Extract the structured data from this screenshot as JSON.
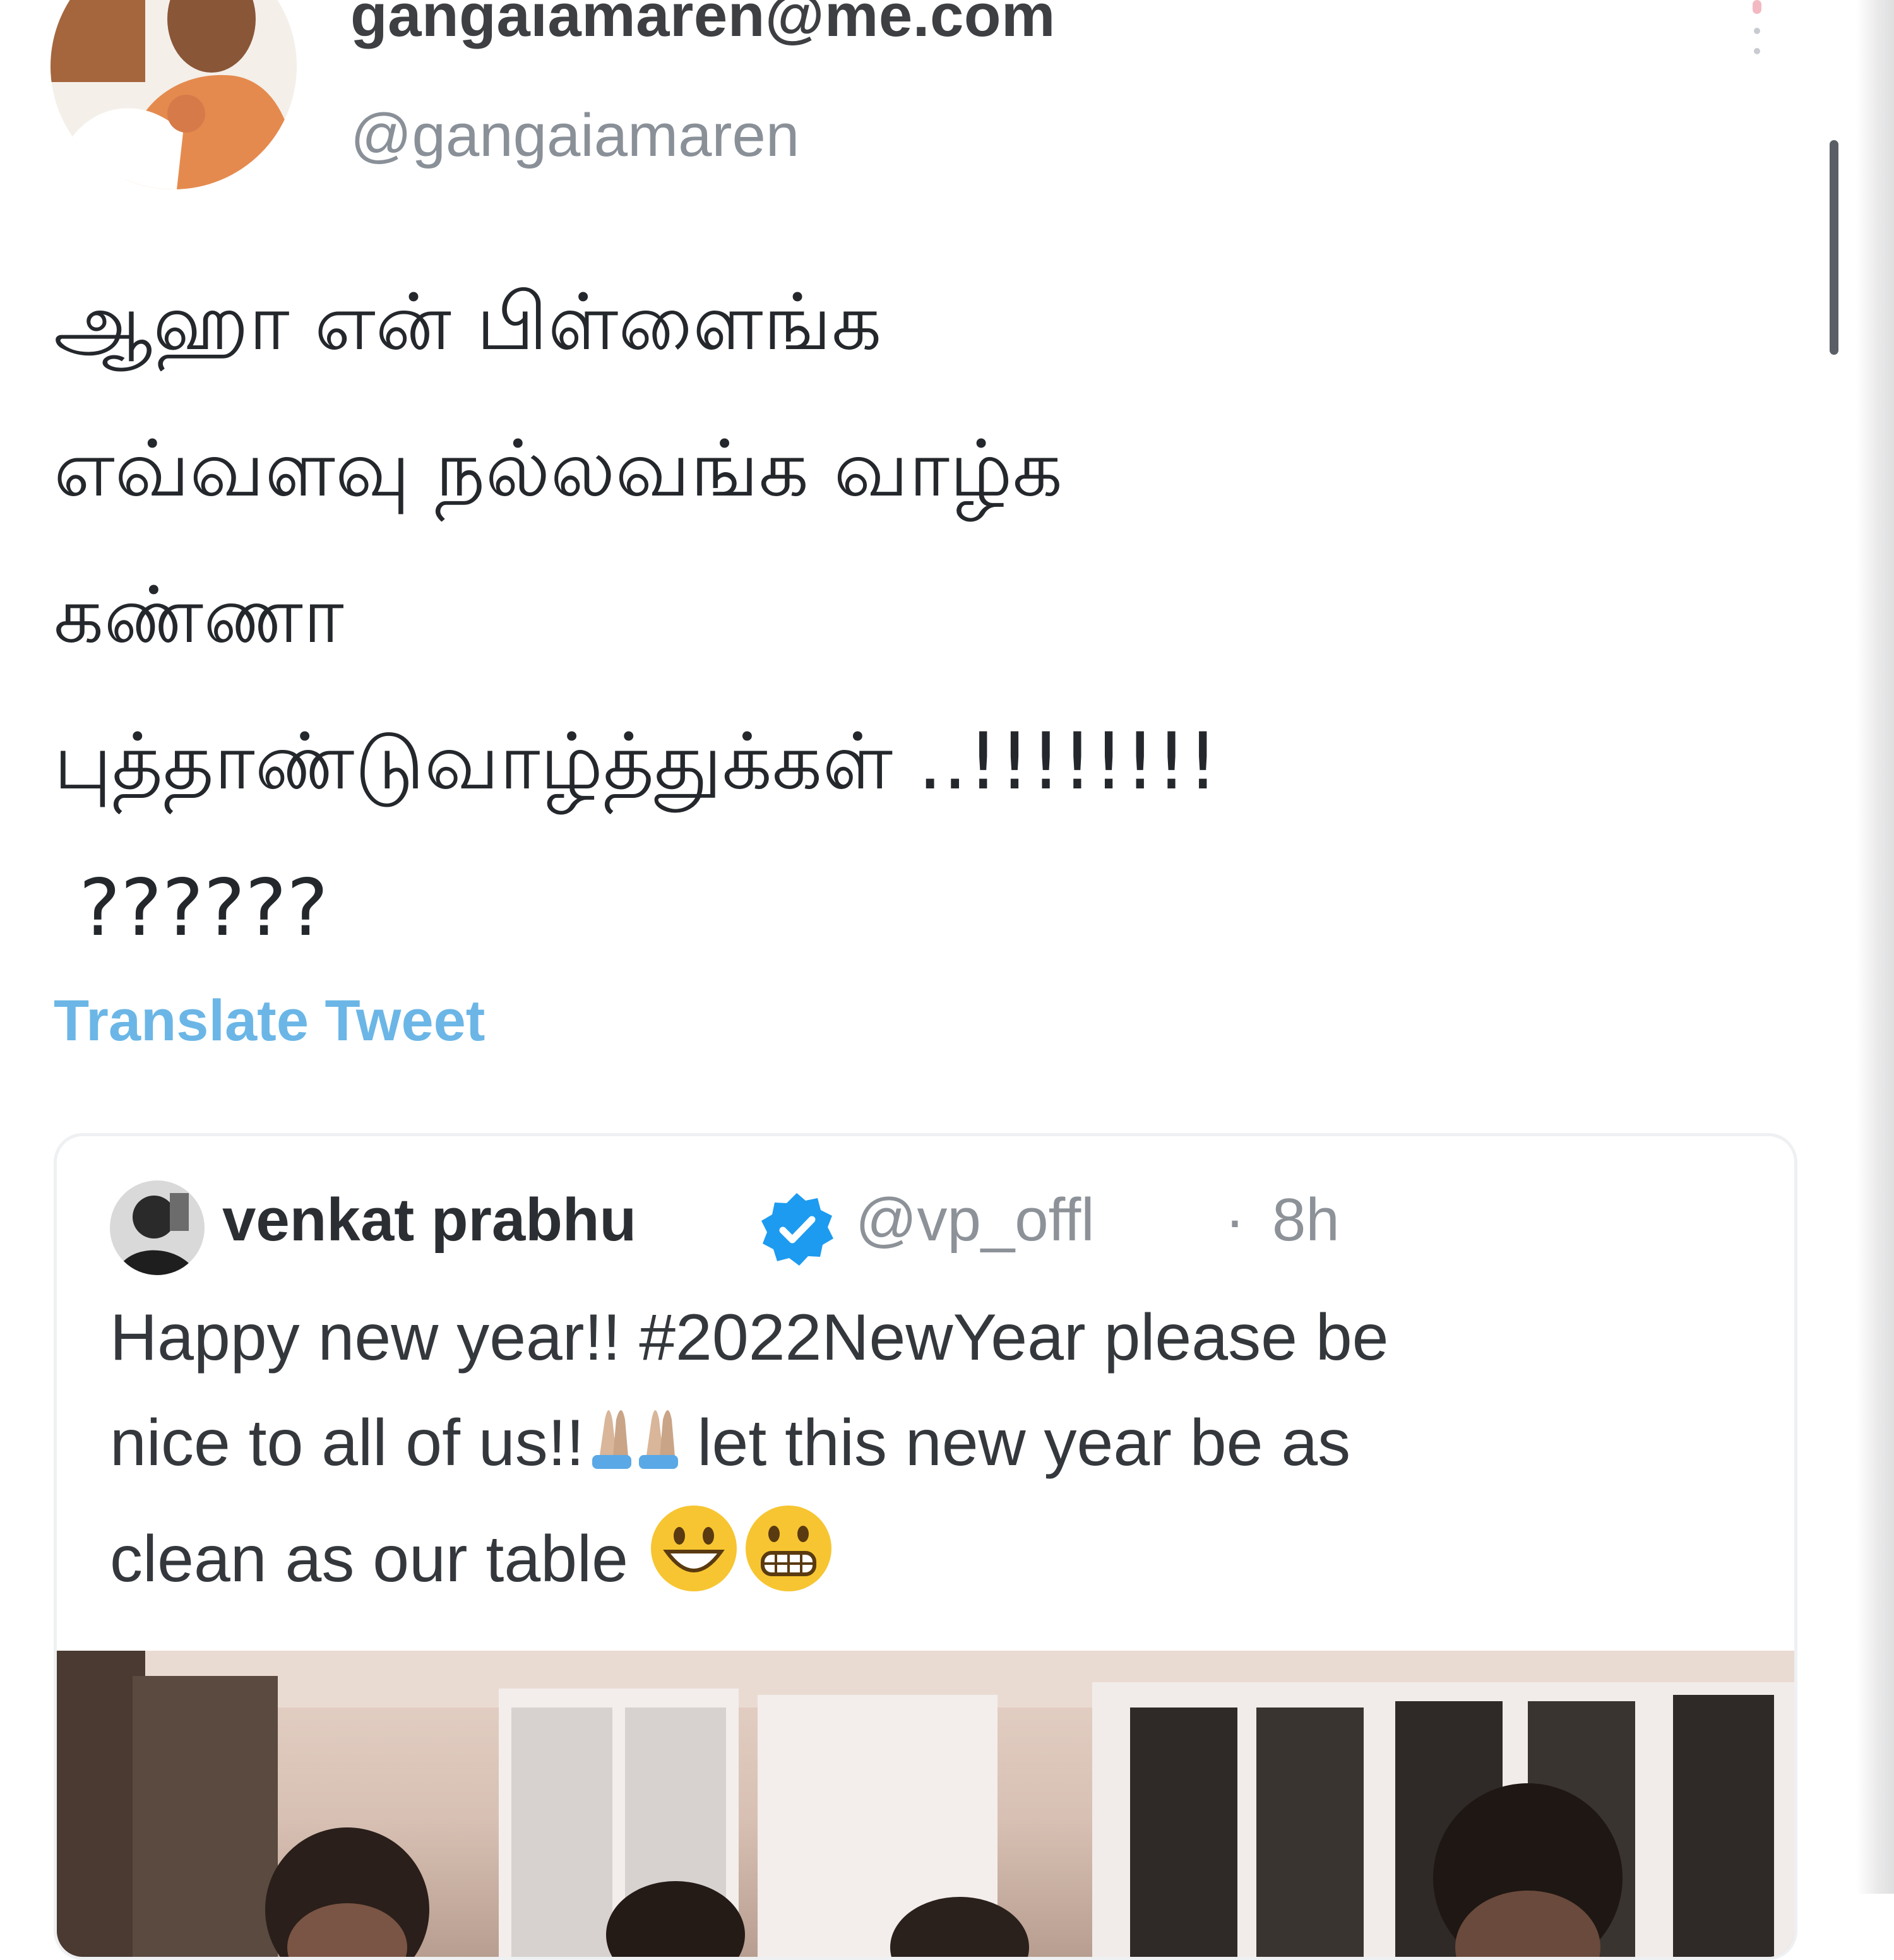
{
  "tweet": {
    "display_name": "gangaiamaren@me.com",
    "handle": "@gangaiamaren",
    "text_lines": [
      "ஆஹா என் பிள்ளைங்க",
      "எவ்வளவு நல்லவங்க வாழ்க",
      "கண்ணா",
      "புத்தாண்டுவாழ்த்துக்கள் ..!!!!!!!!",
      "??????"
    ],
    "translate_label": "Translate Tweet"
  },
  "quoted": {
    "name": "venkat prabhu",
    "handle": "@vp_offl",
    "separator": "·",
    "time": "8h",
    "text_lines": [
      "Happy new year!! #2022NewYear please be",
      "nice to all of us!!",
      " let this new year be as",
      "clean as our table "
    ]
  },
  "icons": {
    "verified": "verified-badge-icon",
    "pray": "folded-hands-emoji",
    "grin": "grinning-face-emoji",
    "grimace": "grimacing-face-emoji",
    "more": "more-options-icon"
  },
  "colors": {
    "link": "#6bb6e6",
    "verified": "#1d9bf0",
    "muted": "#8a9098"
  }
}
